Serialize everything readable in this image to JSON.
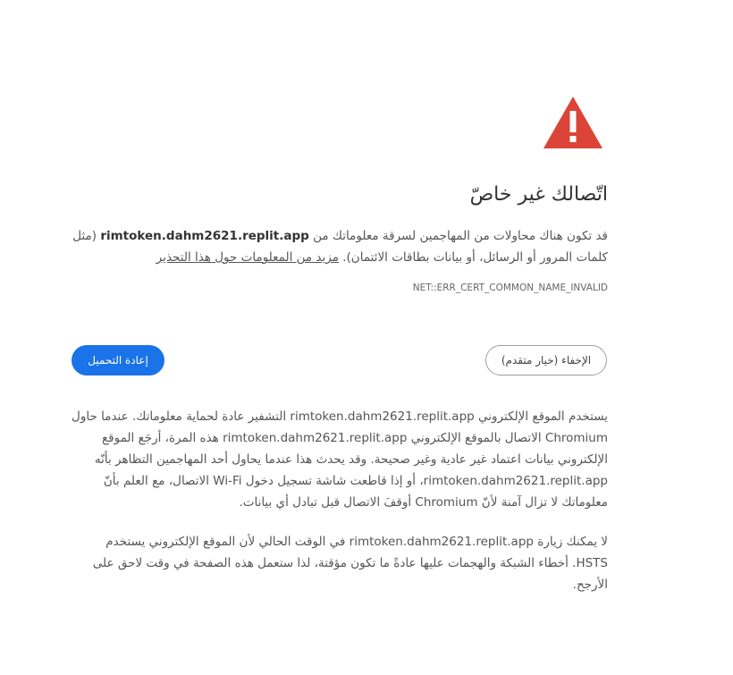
{
  "interstitial": {
    "heading": "اتّصالك غير خاصّ",
    "intro_before_host": "قد تكون هناك محاولات من المهاجمين لسرقة معلوماتك من ",
    "host": "rimtoken.dahm2621.replit.app",
    "intro_after_host": " (مثل كلمات المرور أو الرسائل، أو بيانات بطاقات الائتمان). ",
    "learn_more": "مزيد من المعلومات حول هذا التحذير",
    "error_code": "NET::ERR_CERT_COMMON_NAME_INVALID",
    "reload_button": "إعادة التحميل",
    "hide_advanced_button": "الإخفاء (خيار متقدم)",
    "details_p1_a": "يستخدم الموقع الإلكتروني ",
    "details_p1_b": " التشفير عادة لحماية معلوماتك. عندما حاول Chromium الاتصال بالموقع الإلكتروني ",
    "details_p1_c": " هذه المرة، أرجَع الموقع الإلكتروني بيانات اعتماد غير عادية وغير صحيحة. وقد يحدث هذا عندما يحاول أحد المهاجمين التظاهر بأنّه ",
    "details_p1_d": "، أو إذا قاطعت شاشة تسجيل دخول Wi-Fi الاتصال، مع العلم بأنّ معلوماتك لا تزال آمنة لأنّ Chromium أوقفَ الاتصال قبل تبادل أي بيانات.",
    "details_p2_a": "لا يمكنك زيارة ",
    "details_p2_b": " في الوقت الحالي لأن الموقع الإلكتروني يستخدم HSTS. أخطاء الشبكة والهجمات عليها عادةً ما تكون مؤقتة، لذا ستعمل هذه الصفحة في وقت لاحق على الأرجح."
  },
  "colors": {
    "warning_red": "#db4437",
    "primary_blue": "#1a73e8",
    "text_dark": "#333333",
    "text_body": "#555555"
  },
  "icons": {
    "warning": "warning-triangle-icon"
  }
}
